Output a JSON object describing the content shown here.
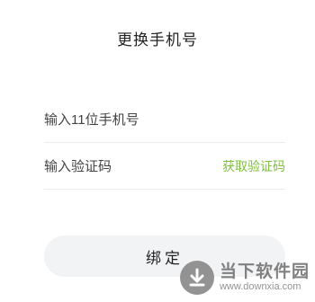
{
  "header": {
    "title": "更换手机号"
  },
  "form": {
    "phone_placeholder": "输入11位手机号",
    "code_placeholder": "输入验证码",
    "get_code_label": "获取验证码",
    "bind_label": "绑定"
  },
  "watermark": {
    "name": "当下软件园",
    "url": "www.downxia.com"
  },
  "colors": {
    "accent": "#7fbf3f",
    "button_bg": "#f2f3f4"
  }
}
